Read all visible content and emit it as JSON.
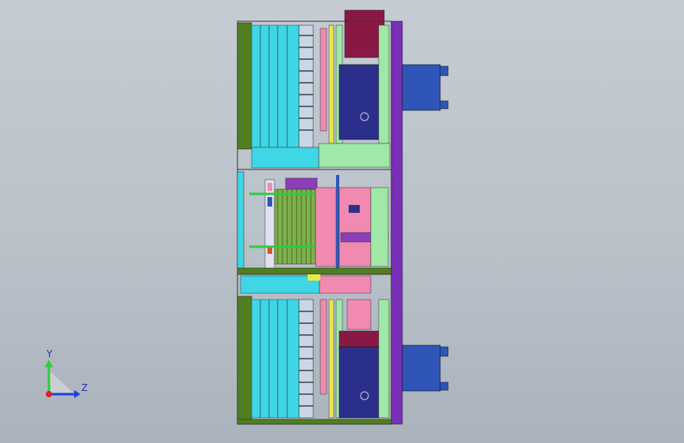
{
  "viewport": {
    "background_top": "#c5ccd3",
    "background_bottom": "#aab3bc"
  },
  "model": {
    "colors": {
      "green_frame": "#4f7f1f",
      "cyan": "#3fd6e6",
      "light_green": "#9fe8a8",
      "pink": "#f08ab0",
      "maroon": "#8a1845",
      "navy": "#2b2f8c",
      "purple": "#7a2fb8",
      "yellow": "#e8e84a",
      "blue": "#2f55b8",
      "dark_line": "#1a1a1a"
    }
  },
  "triad": {
    "y_label": "Y",
    "z_label": "Z",
    "y_color": "#2ecc40",
    "z_color": "#1f3fe0",
    "x_color": "#e02020"
  }
}
